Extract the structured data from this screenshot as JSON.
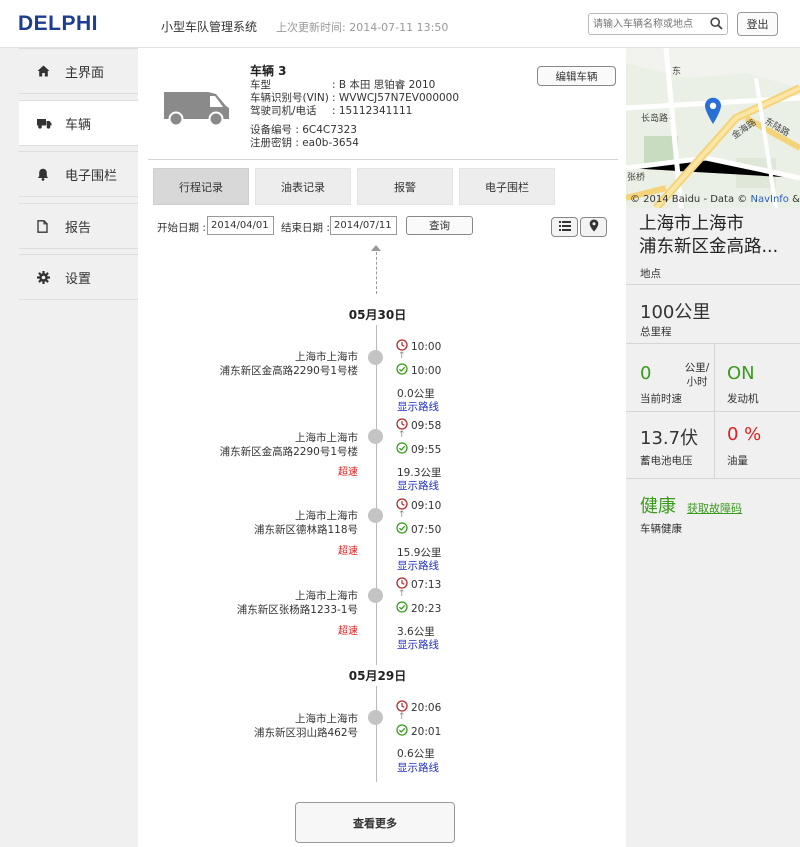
{
  "header": {
    "logo": "DELPHI",
    "app_title": "小型车队管理系统",
    "last_updated": "上次更新时间: 2014-07-11 13:50",
    "search_placeholder": "请输入车辆名称或地点",
    "logout_label": "登出"
  },
  "sidebar": {
    "items": [
      {
        "label": "主界面",
        "icon": "home-icon"
      },
      {
        "label": "车辆",
        "icon": "truck-icon",
        "active": true
      },
      {
        "label": "电子围栏",
        "icon": "bell-icon"
      },
      {
        "label": "报告",
        "icon": "document-icon"
      },
      {
        "label": "设置",
        "icon": "gear-icon"
      }
    ]
  },
  "vehicle": {
    "title": "车辆 3",
    "fields": [
      {
        "key": "车型",
        "value": ": B 本田 思铂睿 2010"
      },
      {
        "key": "车辆识别号(VIN)",
        "value": ": WVWCJ57N7EV000000"
      },
      {
        "key": "驾驶司机/电话",
        "value": ": 15112341111"
      }
    ],
    "device_id": "设备编号 : 6C4C7323",
    "reg_key": "注册密钥 : ea0b-3654",
    "edit_label": "编辑车辆"
  },
  "tabs": [
    {
      "label": "行程记录",
      "active": true
    },
    {
      "label": "油表记录"
    },
    {
      "label": "报警"
    },
    {
      "label": "电子围栏"
    }
  ],
  "filter": {
    "start_label": "开始日期 :",
    "start_value": "2014/04/01",
    "end_label": "结束日期 :",
    "end_value": "2014/07/11",
    "query_label": "查询"
  },
  "timeline": {
    "days": [
      "05月30日",
      "05月29日"
    ],
    "trips": [
      {
        "loc1": "上海市上海市",
        "loc2": "浦东新区金高路2290号1号楼",
        "end": "10:00",
        "start": "10:00",
        "distance": "0.0公里",
        "route": "显示路线",
        "speeding": ""
      },
      {
        "loc1": "上海市上海市",
        "loc2": "浦东新区金高路2290号1号楼",
        "end": "09:58",
        "start": "09:55",
        "distance": "19.3公里",
        "route": "显示路线",
        "speeding": "超速"
      },
      {
        "loc1": "上海市上海市",
        "loc2": "浦东新区德林路118号",
        "end": "09:10",
        "start": "07:50",
        "distance": "15.9公里",
        "route": "显示路线",
        "speeding": "超速"
      },
      {
        "loc1": "上海市上海市",
        "loc2": "浦东新区张杨路1233-1号",
        "end": "07:13",
        "start": "20:23",
        "distance": "3.6公里",
        "route": "显示路线",
        "speeding": "超速"
      },
      {
        "loc1": "上海市上海市",
        "loc2": "浦东新区羽山路462号",
        "end": "20:06",
        "start": "20:01",
        "distance": "0.6公里",
        "route": "显示路线",
        "speeding": ""
      }
    ],
    "more_label": "查看更多"
  },
  "map": {
    "credit_prefix": "© 2014 Baidu - Data © ",
    "credit_link": "NavInfo",
    "credit_suffix": " & C",
    "road_labels": [
      "长岛路",
      "金海路",
      "东陆路",
      "东",
      "张桥"
    ]
  },
  "status": {
    "location": "上海市上海市",
    "location2": "浦东新区金高路...",
    "location_label": "地点",
    "mileage": "100公里",
    "mileage_label": "总里程",
    "speed": "0",
    "speed_unit": "公里/小时",
    "speed_label": "当前时速",
    "engine": "ON",
    "engine_label": "发动机",
    "battery": "13.7伏",
    "battery_label": "蓄电池电压",
    "fuel": "0 %",
    "fuel_label": "油量",
    "health": "健康",
    "diag_link": "获取故障码",
    "health_label": "车辆健康"
  },
  "colors": {
    "brand": "#1d3d8f",
    "green": "#3a9b1c",
    "red": "#e02020",
    "link": "#2231c6"
  }
}
